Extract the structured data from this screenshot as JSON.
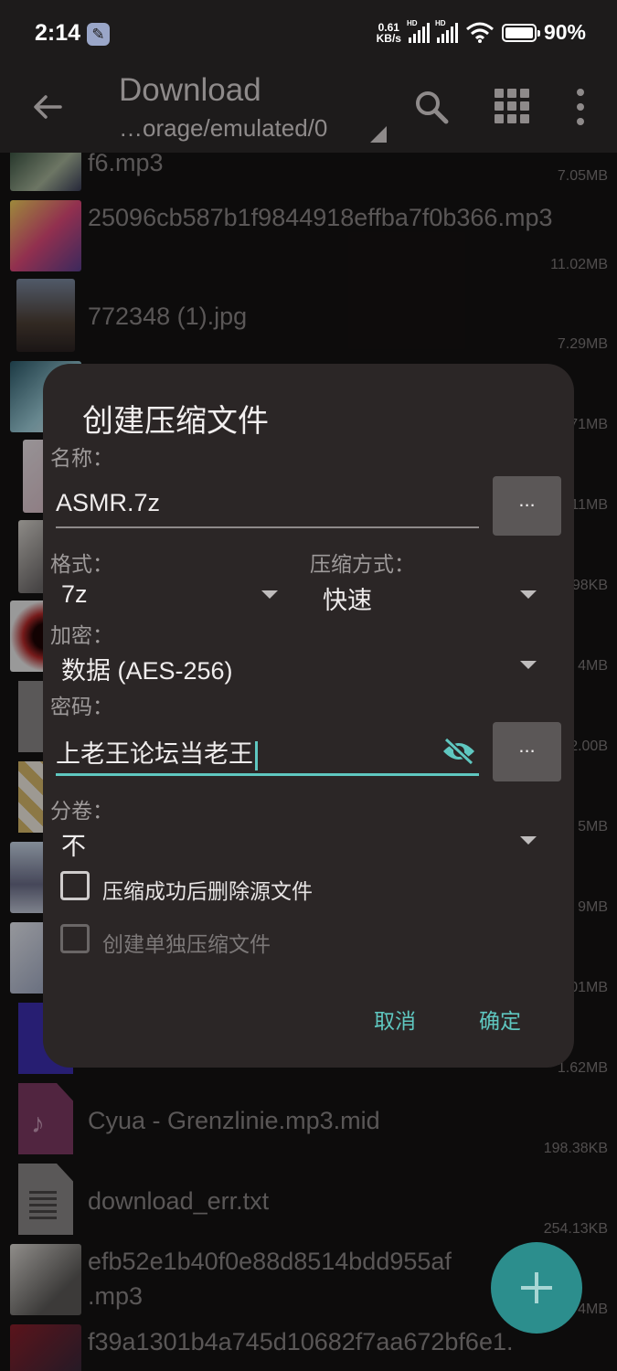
{
  "status_bar": {
    "time": "2:14",
    "speed_value": "0.61",
    "speed_unit": "KB/s",
    "sim1": "HD",
    "sim2": "HD",
    "battery": "90%"
  },
  "toolbar": {
    "title": "Download",
    "path": "…orage/emulated/0"
  },
  "files": [
    {
      "name": "f6.mp3",
      "size": "7.05MB"
    },
    {
      "name": "25096cb587b1f9844918effba7f0b366.mp3",
      "size": "11.02MB"
    },
    {
      "name": "772348 (1).jpg",
      "size": "7.29MB"
    },
    {
      "name": "",
      "size": "71MB"
    },
    {
      "name": "",
      "size": "11MB"
    },
    {
      "name": "",
      "size": "98KB"
    },
    {
      "name": "",
      "size": "4MB"
    },
    {
      "name": "",
      "size": "2.00B"
    },
    {
      "name": "",
      "size": "5MB"
    },
    {
      "name": "",
      "size": "9MB"
    },
    {
      "name": "",
      "size": "01MB"
    },
    {
      "name": "",
      "size": "1.62MB"
    },
    {
      "name": "Cyua - Grenzlinie.mp3.mid",
      "size": "198.38KB"
    },
    {
      "name": "download_err.txt",
      "size": "254.13KB"
    },
    {
      "name": "efb52e1b40f0e88d8514bdd955af",
      "name2": ".mp3",
      "size": "4MB"
    },
    {
      "name": "f39a1301b4a745d10682f7aa672bf6e1.",
      "size": ""
    }
  ],
  "dialog": {
    "title": "创建压缩文件",
    "name_label": "名称：",
    "name_value": "ASMR.7z",
    "browse_label": "...",
    "format_label": "格式：",
    "format_value": "7z",
    "method_label": "压缩方式：",
    "method_value": "快速",
    "encrypt_label": "加密：",
    "encrypt_value": "数据 (AES-256)",
    "password_label": "密码：",
    "password_value": "上老王论坛当老王",
    "split_label": "分卷：",
    "split_value": "不",
    "delete_source_label": "压缩成功后删除源文件",
    "separate_archive_label": "创建单独压缩文件",
    "cancel_label": "取消",
    "ok_label": "确定"
  },
  "colors": {
    "accent": "#5fc7c0",
    "fab": "#2c8e8d",
    "dialog_bg": "#2b2626",
    "app_bg": "#151313"
  },
  "icons": [
    "back-arrow-icon",
    "search-icon",
    "grid-view-icon",
    "more-vert-icon",
    "visibility-off-icon",
    "add-icon",
    "wrench-icon"
  ]
}
